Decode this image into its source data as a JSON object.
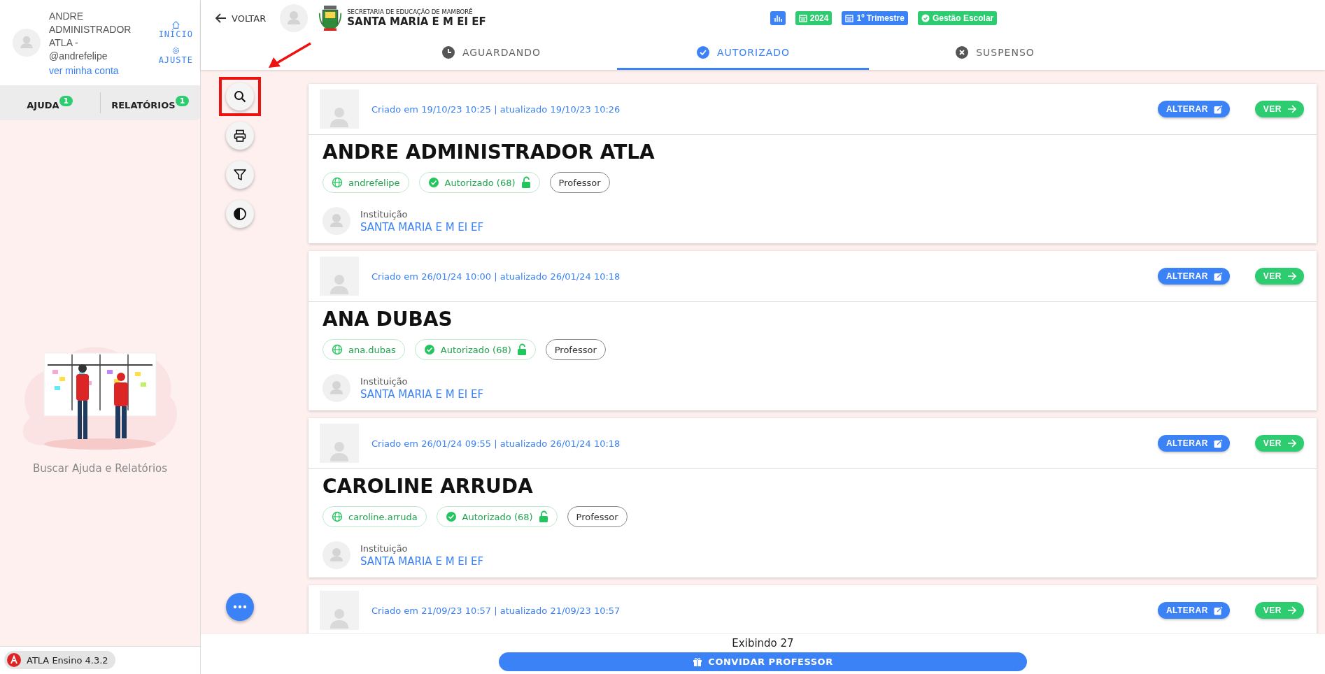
{
  "sidebar": {
    "user_name": "ANDRE ADMINISTRADOR ATLA - @andrefelipe",
    "account_link": "ver minha conta",
    "nav_links": [
      {
        "label": "INÍCIO",
        "kind": "home"
      },
      {
        "label": "AJUSTE",
        "kind": "settings"
      }
    ],
    "tabs": [
      {
        "label": "AJUDA",
        "badge": "1"
      },
      {
        "label": "RELATÓRIOS",
        "badge": "1"
      }
    ],
    "empty_text": "Buscar Ajuda e Relatórios",
    "version": "ATLA Ensino 4.3.2"
  },
  "header": {
    "back": "VOLTAR",
    "org_subtitle": "SECRETARIA DE EDUCAÇÃO DE MAMBORÊ",
    "org_title": "SANTA MARIA E M EI EF",
    "chips": [
      {
        "kind": "chart",
        "color": "#3b82f6"
      },
      {
        "kind": "calendar",
        "label": "2024",
        "color": "#2ecc71"
      },
      {
        "kind": "calendar",
        "label": "1º Trimestre",
        "color": "#3b82f6"
      },
      {
        "kind": "check",
        "label": "Gestão Escolar",
        "color": "#2ecc71"
      }
    ]
  },
  "status_tabs": [
    {
      "label": "AGUARDANDO",
      "kind": "clock",
      "selected": false
    },
    {
      "label": "AUTORIZADO",
      "kind": "check",
      "selected": true
    },
    {
      "label": "SUSPENSO",
      "kind": "cross",
      "selected": false
    }
  ],
  "tools": [
    {
      "kind": "search",
      "highlighted": true
    },
    {
      "kind": "print",
      "highlighted": false
    },
    {
      "kind": "filter",
      "highlighted": false
    },
    {
      "kind": "contrast",
      "highlighted": false
    }
  ],
  "cards": [
    {
      "dates": "Criado em 19/10/23 10:25 | atualizado 19/10/23 10:26",
      "edit": "ALTERAR",
      "view": "VER",
      "name": "ANDRE ADMINISTRADOR ATLA",
      "login": "andrefelipe",
      "status": "Autorizado (68)",
      "role": "Professor",
      "institution_label": "Instituição",
      "institution": "SANTA MARIA E M EI EF"
    },
    {
      "dates": "Criado em 26/01/24 10:00 | atualizado 26/01/24 10:18",
      "edit": "ALTERAR",
      "view": "VER",
      "name": "ANA DUBAS",
      "login": "ana.dubas",
      "status": "Autorizado (68)",
      "role": "Professor",
      "institution_label": "Instituição",
      "institution": "SANTA MARIA E M EI EF"
    },
    {
      "dates": "Criado em 26/01/24 09:55 | atualizado 26/01/24 10:18",
      "edit": "ALTERAR",
      "view": "VER",
      "name": "CAROLINE ARRUDA",
      "login": "caroline.arruda",
      "status": "Autorizado (68)",
      "role": "Professor",
      "institution_label": "Instituição",
      "institution": "SANTA MARIA E M EI EF"
    },
    {
      "dates": "Criado em 21/09/23 10:57 | atualizado 21/09/23 10:57",
      "edit": "ALTERAR",
      "view": "VER"
    }
  ],
  "footer": {
    "count": "Exibindo 27",
    "invite": "CONVIDAR PROFESSOR"
  }
}
